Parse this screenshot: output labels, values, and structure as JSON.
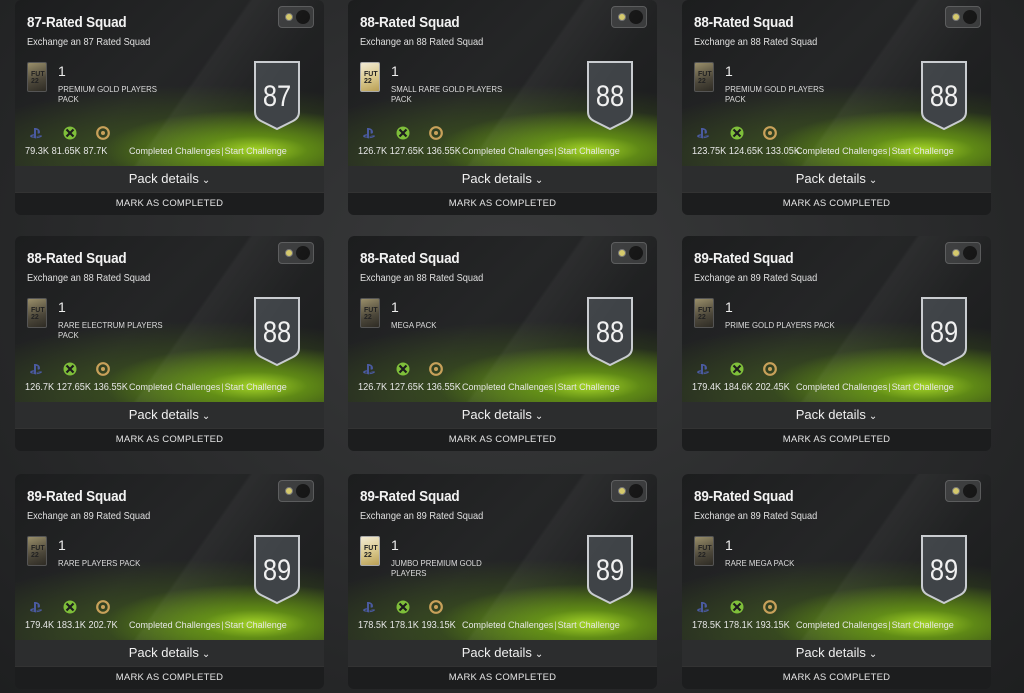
{
  "cards": [
    {
      "title": "87-Rated Squad",
      "subtitle": "Exchange an 87 Rated Squad",
      "qty": "1",
      "pack": "PREMIUM GOLD PLAYERS PACK",
      "pack_style": "dark",
      "rating": "87",
      "price_ps": "79.3K",
      "price_xbox": "81.65K",
      "price_pc": "87.7K",
      "completed": "Completed Challenges",
      "start": "Start Challenge",
      "details": "Pack details",
      "mark": "MARK AS COMPLETED"
    },
    {
      "title": "88-Rated Squad",
      "subtitle": "Exchange an 88 Rated Squad",
      "qty": "1",
      "pack": "SMALL RARE GOLD PLAYERS PACK",
      "pack_style": "light",
      "rating": "88",
      "price_ps": "126.7K",
      "price_xbox": "127.65K",
      "price_pc": "136.55K",
      "completed": "Completed Challenges",
      "start": "Start Challenge",
      "details": "Pack details",
      "mark": "MARK AS COMPLETED"
    },
    {
      "title": "88-Rated Squad",
      "subtitle": "Exchange an 88 Rated Squad",
      "qty": "1",
      "pack": "PREMIUM GOLD PLAYERS PACK",
      "pack_style": "dark",
      "rating": "88",
      "price_ps": "123.75K",
      "price_xbox": "124.65K",
      "price_pc": "133.05K",
      "completed": "Completed Challenges",
      "start": "Start Challenge",
      "details": "Pack details",
      "mark": "MARK AS COMPLETED"
    },
    {
      "title": "88-Rated Squad",
      "subtitle": "Exchange an 88 Rated Squad",
      "qty": "1",
      "pack": "RARE ELECTRUM PLAYERS PACK",
      "pack_style": "dark",
      "rating": "88",
      "price_ps": "126.7K",
      "price_xbox": "127.65K",
      "price_pc": "136.55K",
      "completed": "Completed Challenges",
      "start": "Start Challenge",
      "details": "Pack details",
      "mark": "MARK AS COMPLETED"
    },
    {
      "title": "88-Rated Squad",
      "subtitle": "Exchange an 88 Rated Squad",
      "qty": "1",
      "pack": "MEGA PACK",
      "pack_style": "dark",
      "rating": "88",
      "price_ps": "126.7K",
      "price_xbox": "127.65K",
      "price_pc": "136.55K",
      "completed": "Completed Challenges",
      "start": "Start Challenge",
      "details": "Pack details",
      "mark": "MARK AS COMPLETED"
    },
    {
      "title": "89-Rated Squad",
      "subtitle": "Exchange an 89 Rated Squad",
      "qty": "1",
      "pack": "PRIME GOLD PLAYERS PACK",
      "pack_style": "dark",
      "rating": "89",
      "price_ps": "179.4K",
      "price_xbox": "184.6K",
      "price_pc": "202.45K",
      "completed": "Completed Challenges",
      "start": "Start Challenge",
      "details": "Pack details",
      "mark": "MARK AS COMPLETED"
    },
    {
      "title": "89-Rated Squad",
      "subtitle": "Exchange an 89 Rated Squad",
      "qty": "1",
      "pack": "RARE PLAYERS PACK",
      "pack_style": "dark",
      "rating": "89",
      "price_ps": "179.4K",
      "price_xbox": "183.1K",
      "price_pc": "202.7K",
      "completed": "Completed Challenges",
      "start": "Start Challenge",
      "details": "Pack details",
      "mark": "MARK AS COMPLETED"
    },
    {
      "title": "89-Rated Squad",
      "subtitle": "Exchange an 89 Rated Squad",
      "qty": "1",
      "pack": "JUMBO PREMIUM GOLD PLAYERS",
      "pack_style": "light",
      "rating": "89",
      "price_ps": "178.5K",
      "price_xbox": "178.1K",
      "price_pc": "193.15K",
      "completed": "Completed Challenges",
      "start": "Start Challenge",
      "details": "Pack details",
      "mark": "MARK AS COMPLETED"
    },
    {
      "title": "89-Rated Squad",
      "subtitle": "Exchange an 89 Rated Squad",
      "qty": "1",
      "pack": "RARE MEGA PACK",
      "pack_style": "dark",
      "rating": "89",
      "price_ps": "178.5K",
      "price_xbox": "178.1K",
      "price_pc": "193.15K",
      "completed": "Completed Challenges",
      "start": "Start Challenge",
      "details": "Pack details",
      "mark": "MARK AS COMPLETED"
    }
  ],
  "pack_logo_text": "FUT 22",
  "chevron": "⌄",
  "separator": "|",
  "icons": {
    "ps": "playstation-icon",
    "xbox": "xbox-icon",
    "pc": "coin-icon",
    "toggle": "toggle-icon",
    "pack": "pack-icon",
    "badge": "rating-badge"
  },
  "colors": {
    "background": "#2a2b2c",
    "badge": "#3f4347",
    "badge_border": "#c9ccd0",
    "xbox": "#7fbf3a",
    "coin": "#c8a15a",
    "ps": "#3c4a8a",
    "pitch": "#9ac825"
  }
}
